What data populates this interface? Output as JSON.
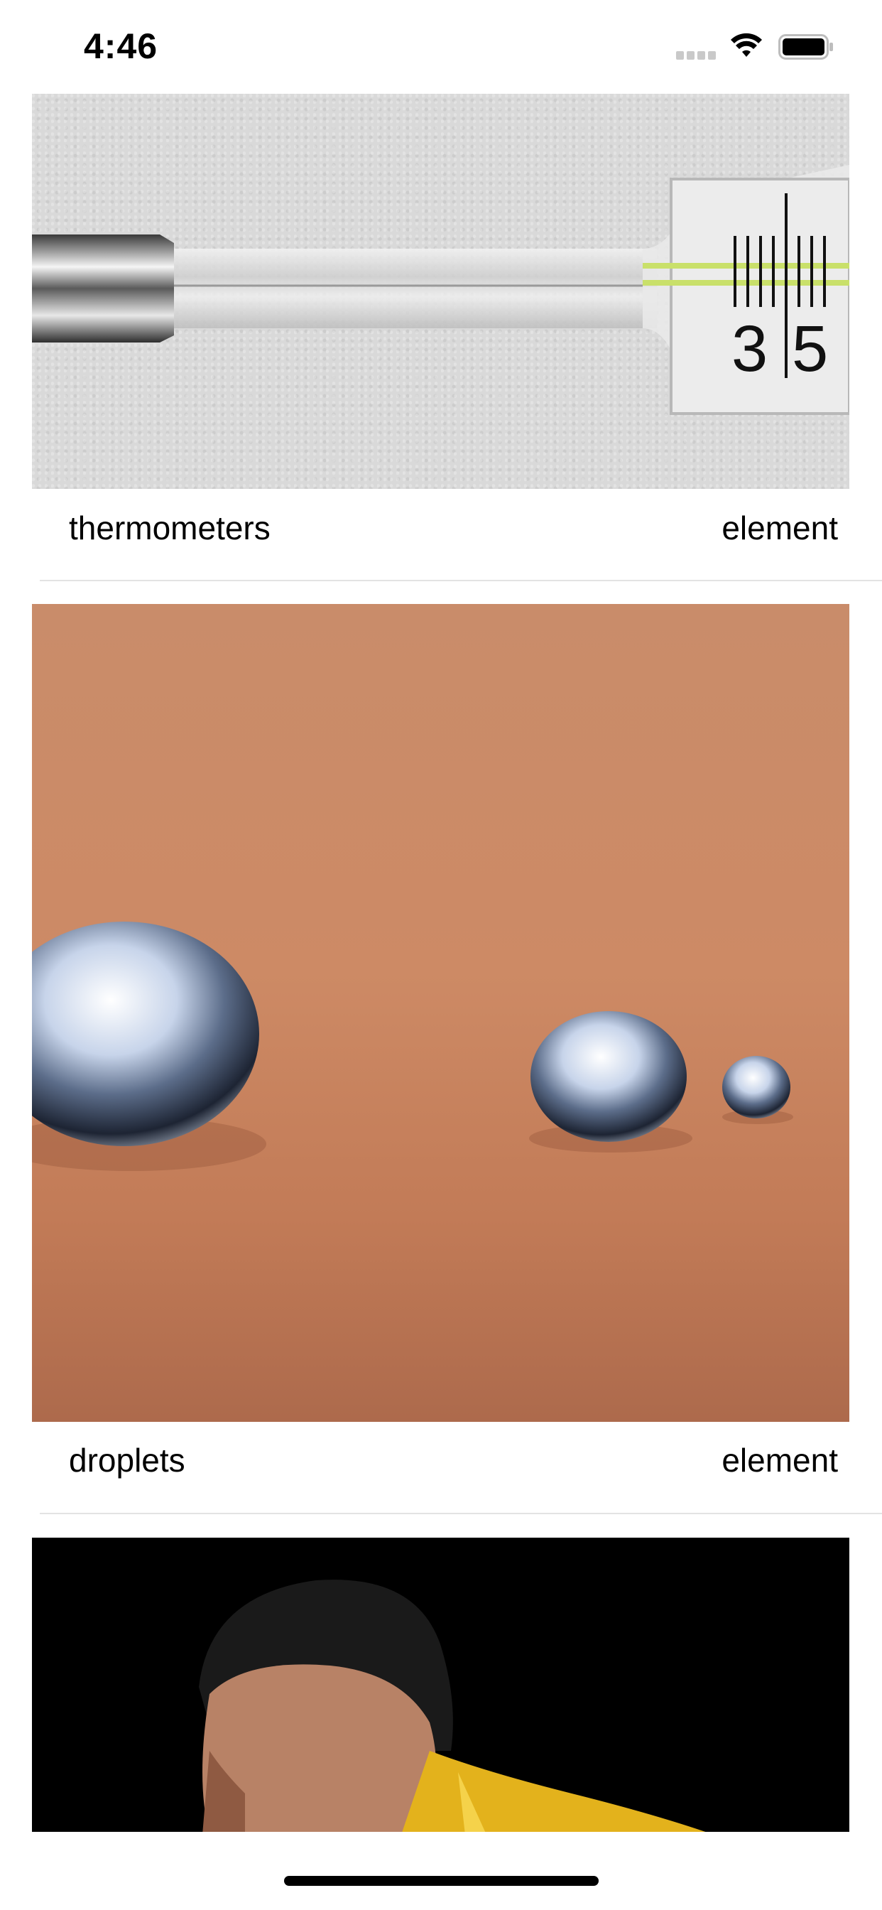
{
  "status_bar": {
    "time": "4:46",
    "icons": [
      "signal-icon",
      "wifi-icon",
      "battery-icon"
    ]
  },
  "feed": {
    "cards": [
      {
        "image_icon": "thermometer-photo",
        "caption": "thermometers",
        "category": "element"
      },
      {
        "image_icon": "mercury-droplets-photo",
        "caption": "droplets",
        "category": "element"
      },
      {
        "image_icon": "portrait-photo",
        "caption": "",
        "category": ""
      }
    ]
  },
  "colors": {
    "background": "#ffffff",
    "divider": "#e3e3e3",
    "text": "#000000",
    "home_indicator": "#000000"
  }
}
